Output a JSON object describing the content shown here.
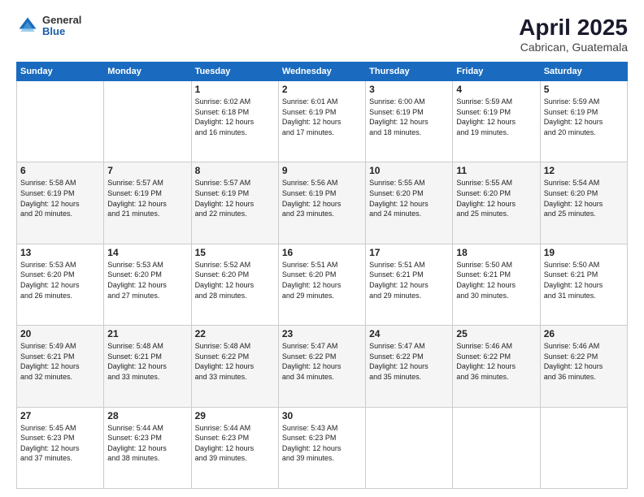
{
  "header": {
    "logo": {
      "general": "General",
      "blue": "Blue"
    },
    "title": "April 2025",
    "location": "Cabrican, Guatemala"
  },
  "weekdays": [
    "Sunday",
    "Monday",
    "Tuesday",
    "Wednesday",
    "Thursday",
    "Friday",
    "Saturday"
  ],
  "weeks": [
    [
      {
        "day": "",
        "info": ""
      },
      {
        "day": "",
        "info": ""
      },
      {
        "day": "1",
        "info": "Sunrise: 6:02 AM\nSunset: 6:18 PM\nDaylight: 12 hours\nand 16 minutes."
      },
      {
        "day": "2",
        "info": "Sunrise: 6:01 AM\nSunset: 6:19 PM\nDaylight: 12 hours\nand 17 minutes."
      },
      {
        "day": "3",
        "info": "Sunrise: 6:00 AM\nSunset: 6:19 PM\nDaylight: 12 hours\nand 18 minutes."
      },
      {
        "day": "4",
        "info": "Sunrise: 5:59 AM\nSunset: 6:19 PM\nDaylight: 12 hours\nand 19 minutes."
      },
      {
        "day": "5",
        "info": "Sunrise: 5:59 AM\nSunset: 6:19 PM\nDaylight: 12 hours\nand 20 minutes."
      }
    ],
    [
      {
        "day": "6",
        "info": "Sunrise: 5:58 AM\nSunset: 6:19 PM\nDaylight: 12 hours\nand 20 minutes."
      },
      {
        "day": "7",
        "info": "Sunrise: 5:57 AM\nSunset: 6:19 PM\nDaylight: 12 hours\nand 21 minutes."
      },
      {
        "day": "8",
        "info": "Sunrise: 5:57 AM\nSunset: 6:19 PM\nDaylight: 12 hours\nand 22 minutes."
      },
      {
        "day": "9",
        "info": "Sunrise: 5:56 AM\nSunset: 6:19 PM\nDaylight: 12 hours\nand 23 minutes."
      },
      {
        "day": "10",
        "info": "Sunrise: 5:55 AM\nSunset: 6:20 PM\nDaylight: 12 hours\nand 24 minutes."
      },
      {
        "day": "11",
        "info": "Sunrise: 5:55 AM\nSunset: 6:20 PM\nDaylight: 12 hours\nand 25 minutes."
      },
      {
        "day": "12",
        "info": "Sunrise: 5:54 AM\nSunset: 6:20 PM\nDaylight: 12 hours\nand 25 minutes."
      }
    ],
    [
      {
        "day": "13",
        "info": "Sunrise: 5:53 AM\nSunset: 6:20 PM\nDaylight: 12 hours\nand 26 minutes."
      },
      {
        "day": "14",
        "info": "Sunrise: 5:53 AM\nSunset: 6:20 PM\nDaylight: 12 hours\nand 27 minutes."
      },
      {
        "day": "15",
        "info": "Sunrise: 5:52 AM\nSunset: 6:20 PM\nDaylight: 12 hours\nand 28 minutes."
      },
      {
        "day": "16",
        "info": "Sunrise: 5:51 AM\nSunset: 6:20 PM\nDaylight: 12 hours\nand 29 minutes."
      },
      {
        "day": "17",
        "info": "Sunrise: 5:51 AM\nSunset: 6:21 PM\nDaylight: 12 hours\nand 29 minutes."
      },
      {
        "day": "18",
        "info": "Sunrise: 5:50 AM\nSunset: 6:21 PM\nDaylight: 12 hours\nand 30 minutes."
      },
      {
        "day": "19",
        "info": "Sunrise: 5:50 AM\nSunset: 6:21 PM\nDaylight: 12 hours\nand 31 minutes."
      }
    ],
    [
      {
        "day": "20",
        "info": "Sunrise: 5:49 AM\nSunset: 6:21 PM\nDaylight: 12 hours\nand 32 minutes."
      },
      {
        "day": "21",
        "info": "Sunrise: 5:48 AM\nSunset: 6:21 PM\nDaylight: 12 hours\nand 33 minutes."
      },
      {
        "day": "22",
        "info": "Sunrise: 5:48 AM\nSunset: 6:22 PM\nDaylight: 12 hours\nand 33 minutes."
      },
      {
        "day": "23",
        "info": "Sunrise: 5:47 AM\nSunset: 6:22 PM\nDaylight: 12 hours\nand 34 minutes."
      },
      {
        "day": "24",
        "info": "Sunrise: 5:47 AM\nSunset: 6:22 PM\nDaylight: 12 hours\nand 35 minutes."
      },
      {
        "day": "25",
        "info": "Sunrise: 5:46 AM\nSunset: 6:22 PM\nDaylight: 12 hours\nand 36 minutes."
      },
      {
        "day": "26",
        "info": "Sunrise: 5:46 AM\nSunset: 6:22 PM\nDaylight: 12 hours\nand 36 minutes."
      }
    ],
    [
      {
        "day": "27",
        "info": "Sunrise: 5:45 AM\nSunset: 6:23 PM\nDaylight: 12 hours\nand 37 minutes."
      },
      {
        "day": "28",
        "info": "Sunrise: 5:44 AM\nSunset: 6:23 PM\nDaylight: 12 hours\nand 38 minutes."
      },
      {
        "day": "29",
        "info": "Sunrise: 5:44 AM\nSunset: 6:23 PM\nDaylight: 12 hours\nand 39 minutes."
      },
      {
        "day": "30",
        "info": "Sunrise: 5:43 AM\nSunset: 6:23 PM\nDaylight: 12 hours\nand 39 minutes."
      },
      {
        "day": "",
        "info": ""
      },
      {
        "day": "",
        "info": ""
      },
      {
        "day": "",
        "info": ""
      }
    ]
  ]
}
